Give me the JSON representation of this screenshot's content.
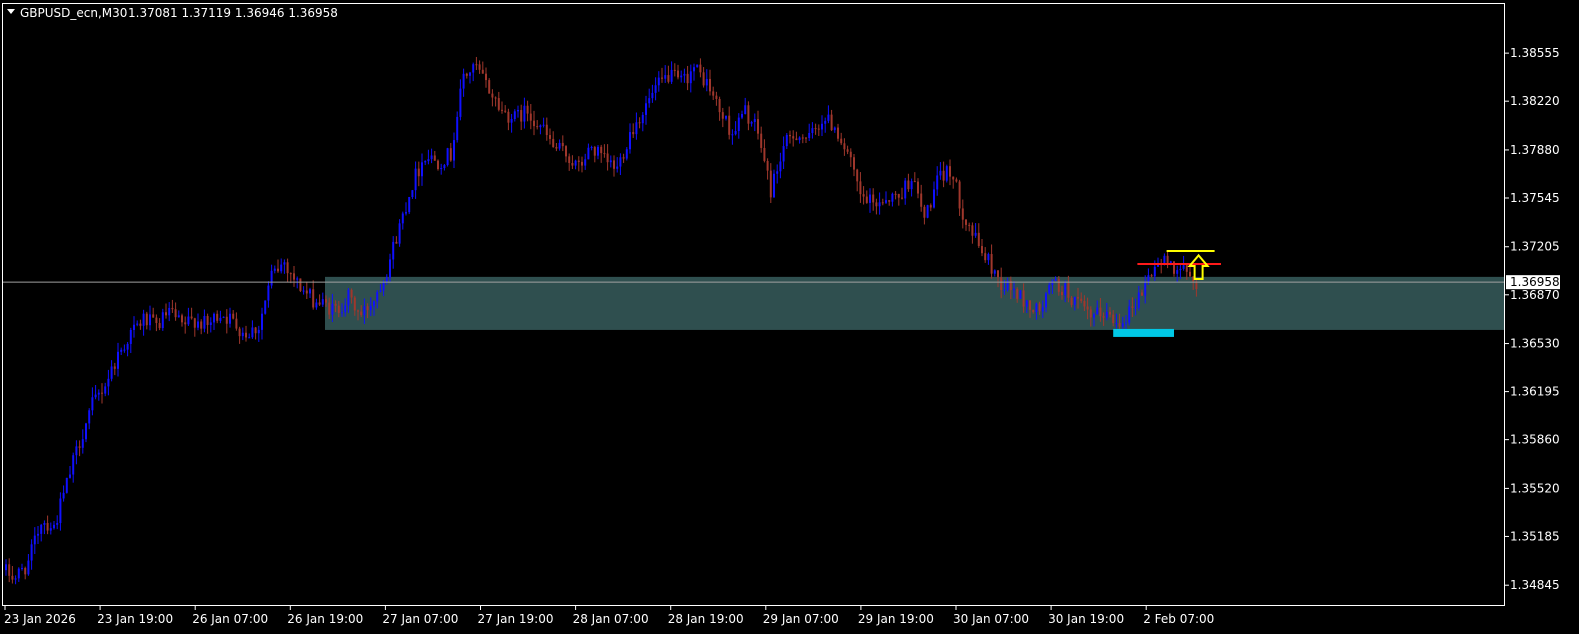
{
  "header": {
    "symbol": "GBPUSD_ecn,M30",
    "ohlc": "1.37081 1.37119 1.36946 1.36958"
  },
  "colors": {
    "background": "#000000",
    "frame": "#ffffff",
    "bull": "#1010ff",
    "bear": "#a0372c",
    "zone": "#2f4f4f",
    "support": "#00c8e6",
    "resistance": "#ff1a1a",
    "target": "#ffff00",
    "bid_line": "#a0a0a0"
  },
  "chart_data": {
    "type": "candlestick",
    "title": "GBPUSD_ecn,M30",
    "current_price": "1.36958",
    "ylim": [
      1.347,
      1.388
    ],
    "y_ticks": [
      "1.38555",
      "1.38220",
      "1.37880",
      "1.37545",
      "1.37205",
      "1.36870",
      "1.36530",
      "1.36195",
      "1.35860",
      "1.35520",
      "1.35185",
      "1.34845"
    ],
    "x_ticks": [
      "23 Jan 2026",
      "23 Jan 19:00",
      "26 Jan 07:00",
      "26 Jan 19:00",
      "27 Jan 07:00",
      "27 Jan 19:00",
      "28 Jan 07:00",
      "28 Jan 19:00",
      "29 Jan 07:00",
      "29 Jan 19:00",
      "30 Jan 07:00",
      "30 Jan 19:00",
      "2 Feb 07:00"
    ],
    "grid": false,
    "path_points": [
      [
        0,
        1.3495
      ],
      [
        4,
        1.349
      ],
      [
        8,
        1.35
      ],
      [
        12,
        1.353
      ],
      [
        16,
        1.3525
      ],
      [
        20,
        1.3555
      ],
      [
        24,
        1.3585
      ],
      [
        28,
        1.361
      ],
      [
        32,
        1.3625
      ],
      [
        36,
        1.3645
      ],
      [
        40,
        1.366
      ],
      [
        44,
        1.367
      ],
      [
        48,
        1.3665
      ],
      [
        52,
        1.3675
      ],
      [
        56,
        1.3665
      ],
      [
        60,
        1.367
      ],
      [
        64,
        1.3665
      ],
      [
        68,
        1.3675
      ],
      [
        72,
        1.3668
      ],
      [
        76,
        1.366
      ],
      [
        80,
        1.3665
      ],
      [
        84,
        1.37
      ],
      [
        88,
        1.371
      ],
      [
        92,
        1.3695
      ],
      [
        96,
        1.3685
      ],
      [
        100,
        1.368
      ],
      [
        104,
        1.3676
      ],
      [
        108,
        1.3685
      ],
      [
        112,
        1.3672
      ],
      [
        116,
        1.3685
      ],
      [
        120,
        1.3705
      ],
      [
        124,
        1.3735
      ],
      [
        128,
        1.3765
      ],
      [
        132,
        1.3785
      ],
      [
        136,
        1.378
      ],
      [
        140,
        1.3785
      ],
      [
        144,
        1.384
      ],
      [
        148,
        1.3845
      ],
      [
        152,
        1.383
      ],
      [
        156,
        1.3815
      ],
      [
        160,
        1.381
      ],
      [
        164,
        1.3815
      ],
      [
        168,
        1.3805
      ],
      [
        172,
        1.379
      ],
      [
        176,
        1.3785
      ],
      [
        180,
        1.3775
      ],
      [
        184,
        1.379
      ],
      [
        188,
        1.378
      ],
      [
        192,
        1.3775
      ],
      [
        196,
        1.38
      ],
      [
        200,
        1.3815
      ],
      [
        204,
        1.383
      ],
      [
        208,
        1.384
      ],
      [
        212,
        1.3835
      ],
      [
        216,
        1.3845
      ],
      [
        220,
        1.3835
      ],
      [
        224,
        1.3815
      ],
      [
        228,
        1.38
      ],
      [
        232,
        1.3815
      ],
      [
        236,
        1.38
      ],
      [
        240,
        1.376
      ],
      [
        244,
        1.379
      ],
      [
        248,
        1.38
      ],
      [
        252,
        1.3795
      ],
      [
        256,
        1.381
      ],
      [
        260,
        1.3805
      ],
      [
        264,
        1.3785
      ],
      [
        268,
        1.3755
      ],
      [
        272,
        1.375
      ],
      [
        276,
        1.3755
      ],
      [
        280,
        1.3755
      ],
      [
        284,
        1.377
      ],
      [
        288,
        1.374
      ],
      [
        292,
        1.3765
      ],
      [
        296,
        1.3775
      ],
      [
        300,
        1.3745
      ],
      [
        304,
        1.3725
      ],
      [
        308,
        1.371
      ],
      [
        312,
        1.3695
      ],
      [
        316,
        1.369
      ],
      [
        320,
        1.368
      ],
      [
        324,
        1.3675
      ],
      [
        328,
        1.3695
      ],
      [
        332,
        1.369
      ],
      [
        336,
        1.368
      ],
      [
        340,
        1.367
      ],
      [
        344,
        1.3675
      ],
      [
        348,
        1.3668
      ],
      [
        352,
        1.3675
      ],
      [
        356,
        1.369
      ],
      [
        360,
        1.3708
      ],
      [
        364,
        1.371
      ],
      [
        368,
        1.3705
      ],
      [
        372,
        1.3696
      ]
    ],
    "annotations": {
      "zone": {
        "x_start": 100,
        "x_end": 400,
        "y_low": 1.36625,
        "y_high": 1.36995
      },
      "support": {
        "x_start": 346,
        "x_end": 365,
        "y": 1.36618
      },
      "resistance": {
        "x_start": 352,
        "x_end": 380,
        "y": 1.37085
      },
      "target": {
        "x_start": 363,
        "x_end": 378,
        "y": 1.37175
      },
      "arrow": {
        "x": 373,
        "y_top": 1.37145,
        "y_bottom": 1.3698,
        "direction": "up"
      }
    }
  }
}
